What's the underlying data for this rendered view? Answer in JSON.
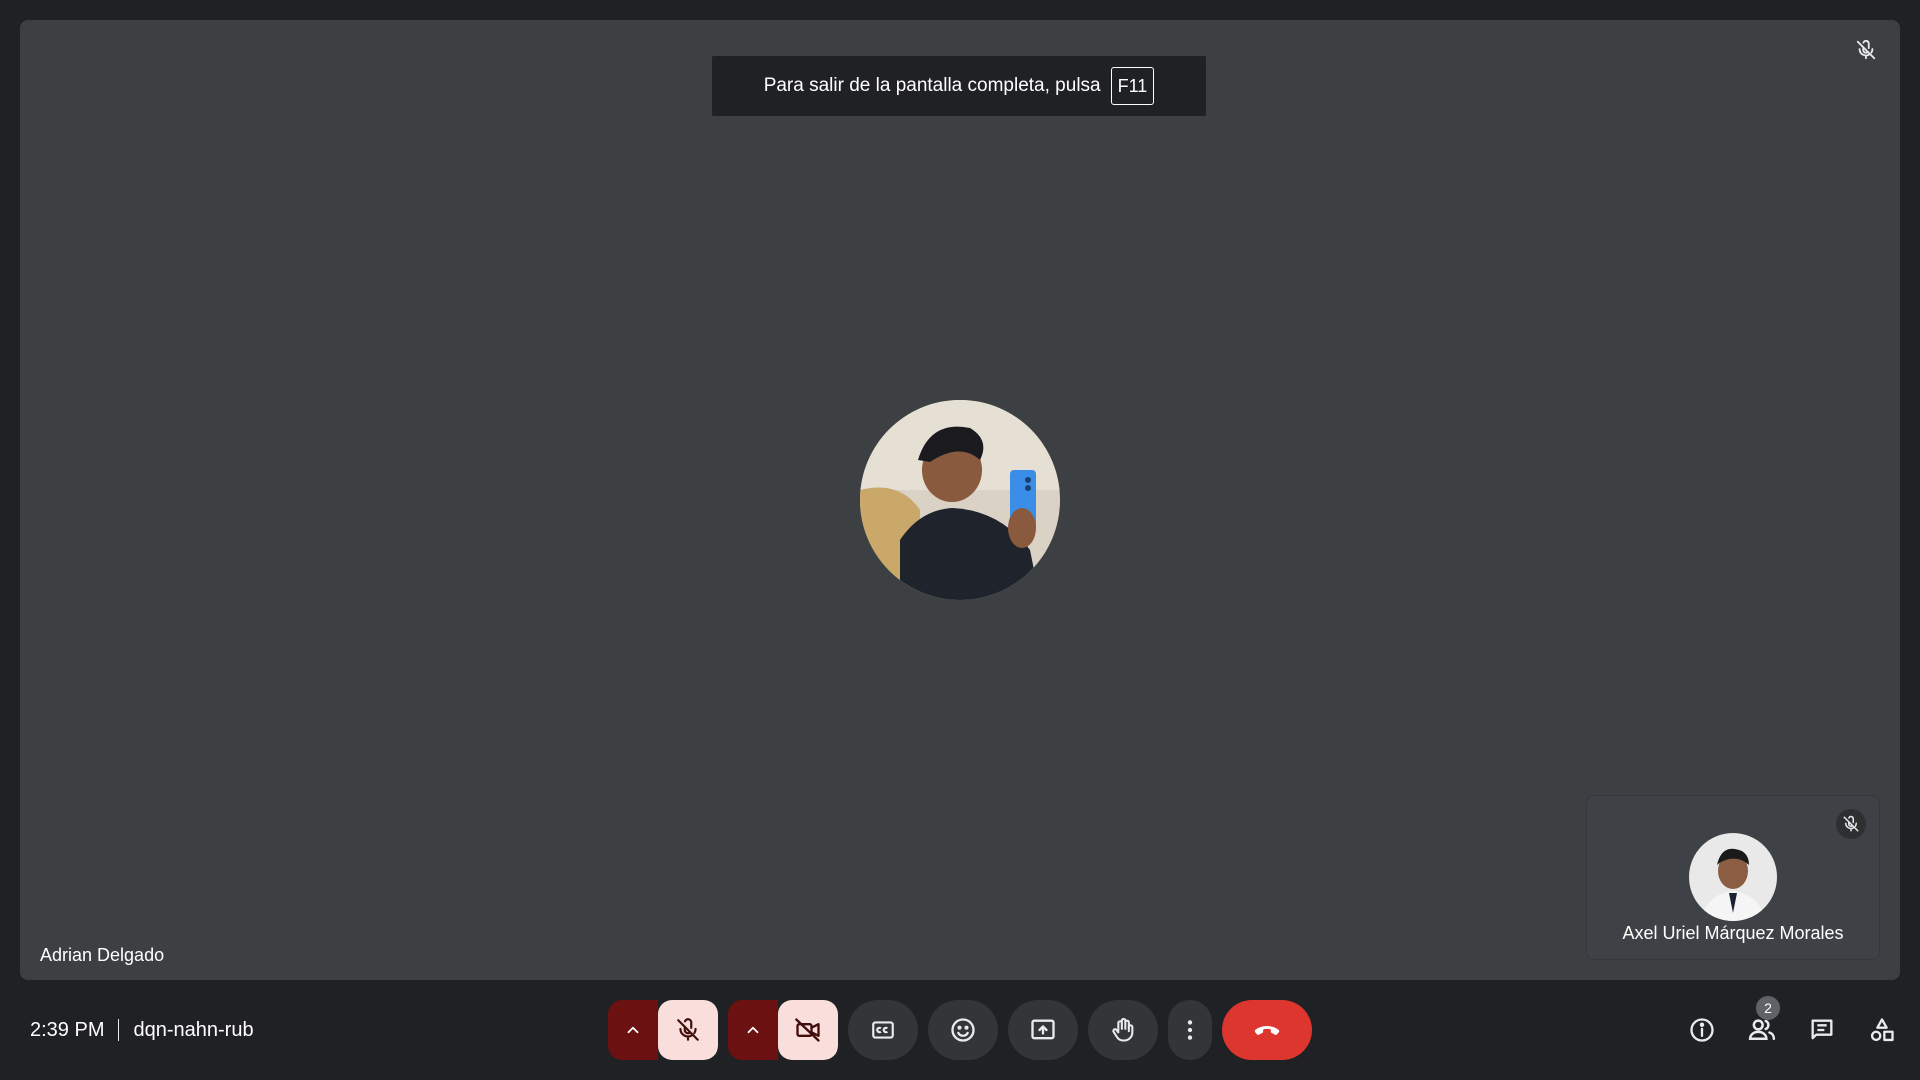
{
  "fullscreen_banner": {
    "text": "Para salir de la pantalla completa, pulsa",
    "key": "F11"
  },
  "main_participant": {
    "name": "Adrian Delgado",
    "muted": true
  },
  "self_tile": {
    "name": "Axel Uriel Márquez Morales",
    "muted": true
  },
  "meeting": {
    "time": "2:39 PM",
    "code": "dqn-nahn-rub"
  },
  "participants": {
    "count": "2"
  },
  "controls": {
    "mic_state": "muted",
    "camera_state": "off",
    "icons": [
      "chevron-up-icon",
      "mic-off-icon",
      "chevron-up-icon",
      "videocam-off-icon",
      "captions-icon",
      "emoji-icon",
      "present-icon",
      "raise-hand-icon",
      "more-vert-icon",
      "call-end-icon"
    ]
  },
  "right_icons": [
    "info-icon",
    "people-icon",
    "chat-icon",
    "activities-icon"
  ],
  "colors": {
    "background": "#202124",
    "stage": "#3c4043",
    "hangup": "#dc362e",
    "muted_bg": "#f9dedc",
    "caret_bg": "#6b1111"
  }
}
